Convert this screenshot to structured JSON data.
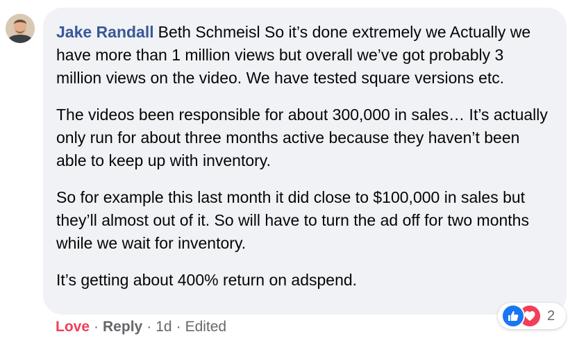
{
  "comment": {
    "author": "Jake Randall",
    "paragraphs": [
      "Beth Schmeisl So it’s done extremely we Actually we have more than 1 million views but overall we’ve got probably 3 million views on the video. We have tested square versions etc.",
      "The videos been responsible for about 300,000 in sales… It’s actually only run for about three months active because they haven’t been able to keep up with inventory.",
      "So for example this last month it did close to $100,000 in sales but they’ll almost out of it. So will have to turn the ad off for two months while we wait for inventory.",
      "It’s getting about 400% return on adspend."
    ]
  },
  "reactions": {
    "icons": [
      "like-icon",
      "love-icon"
    ],
    "count": "2"
  },
  "actions": {
    "love": "Love",
    "reply": "Reply",
    "time": "1d",
    "edited": "Edited",
    "separator": "·"
  },
  "colors": {
    "author": "#385898",
    "bubble": "#f0f2f5",
    "love": "#f33e58",
    "like": "#1877f2",
    "meta": "#65676b"
  }
}
